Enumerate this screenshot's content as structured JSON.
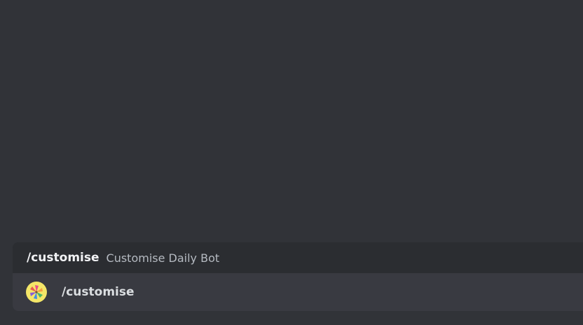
{
  "autocomplete": {
    "header": {
      "command": "/customise",
      "description": "Customise Daily Bot"
    },
    "items": [
      {
        "label": "/customise",
        "avatar_icon": "pinwheel-icon"
      }
    ]
  },
  "colors": {
    "background": "#313338",
    "panel": "#2b2d31",
    "selected_row": "#393a41",
    "avatar_bg": "#f4e668"
  }
}
